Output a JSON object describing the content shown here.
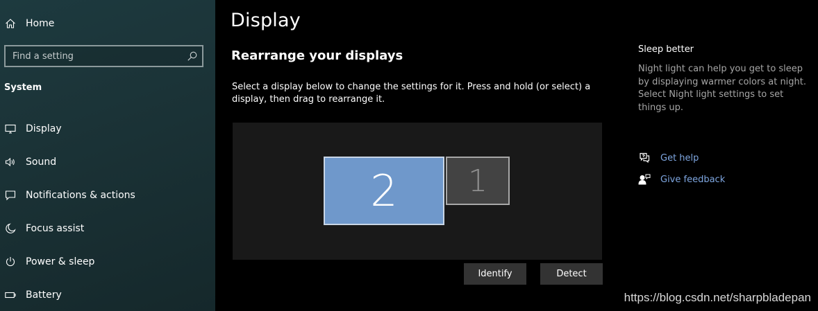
{
  "sidebar": {
    "home_label": "Home",
    "search_placeholder": "Find a setting",
    "section_title": "System",
    "items": [
      {
        "label": "Display",
        "icon": "display-icon"
      },
      {
        "label": "Sound",
        "icon": "speaker-icon"
      },
      {
        "label": "Notifications & actions",
        "icon": "notification-icon"
      },
      {
        "label": "Focus assist",
        "icon": "moon-icon"
      },
      {
        "label": "Power & sleep",
        "icon": "power-icon"
      },
      {
        "label": "Battery",
        "icon": "battery-icon"
      }
    ]
  },
  "main": {
    "title": "Display",
    "subheading": "Rearrange your displays",
    "instructions": "Select a display below to change the settings for it. Press and hold (or select) a display, then drag to rearrange it.",
    "monitors": [
      {
        "number": "2",
        "selected": true
      },
      {
        "number": "1",
        "selected": false
      }
    ],
    "identify_label": "Identify",
    "detect_label": "Detect"
  },
  "right_panel": {
    "heading": "Sleep better",
    "text": "Night light can help you get to sleep by displaying warmer colors at night. Select Night light settings to set things up.",
    "links": [
      {
        "label": "Get help",
        "icon": "help-chat-icon"
      },
      {
        "label": "Give feedback",
        "icon": "feedback-person-icon"
      }
    ]
  },
  "watermark": "https://blog.csdn.net/sharpbladepan",
  "colors": {
    "accent": "#6f98cb",
    "link": "#7ea6e0",
    "sidebar_bg": "#1b3337",
    "button_bg": "#333333"
  }
}
